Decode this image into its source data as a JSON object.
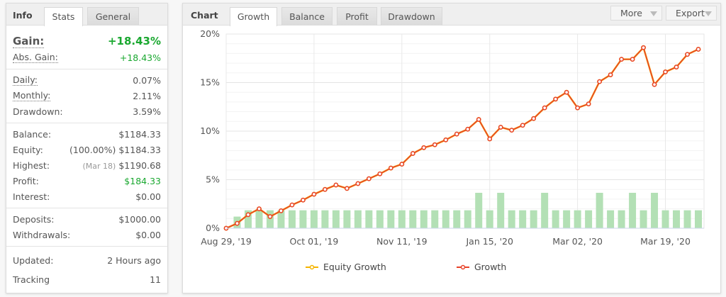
{
  "info": {
    "title": "Info",
    "tabs": [
      {
        "label": "Stats",
        "active": true
      },
      {
        "label": "General",
        "active": false
      }
    ],
    "gain": {
      "label": "Gain:",
      "value": "+18.43%"
    },
    "abs_gain": {
      "label": "Abs. Gain:",
      "value": "+18.43%"
    },
    "daily": {
      "label": "Daily:",
      "value": "0.07%"
    },
    "monthly": {
      "label": "Monthly:",
      "value": "2.11%"
    },
    "drawdown": {
      "label": "Drawdown:",
      "value": "3.59%"
    },
    "balance": {
      "label": "Balance:",
      "value": "$1184.33"
    },
    "equity": {
      "label": "Equity:",
      "note": "(100.00%)",
      "value": "$1184.33"
    },
    "highest": {
      "label": "Highest:",
      "note": "(Mar 18)",
      "value": "$1190.68"
    },
    "profit": {
      "label": "Profit:",
      "value": "$184.33"
    },
    "interest": {
      "label": "Interest:",
      "value": "$0.00"
    },
    "deposits": {
      "label": "Deposits:",
      "value": "$1000.00"
    },
    "withdrawals": {
      "label": "Withdrawals:",
      "value": "$0.00"
    },
    "updated": {
      "label": "Updated:",
      "value": "2 Hours ago"
    },
    "tracking": {
      "label": "Tracking",
      "value": "11"
    }
  },
  "chart_panel": {
    "title": "Chart",
    "tabs": [
      {
        "label": "Growth",
        "active": true
      },
      {
        "label": "Balance"
      },
      {
        "label": "Profit"
      },
      {
        "label": "Drawdown"
      }
    ],
    "more_label": "More",
    "export_label": "Export"
  },
  "colors": {
    "green": "#1aa830",
    "growth": "#e8432a",
    "equity": "#f5b400",
    "bar": "#b3e0b5"
  },
  "chart_data": {
    "type": "line",
    "ylim": [
      0,
      20
    ],
    "yticks": [
      "0%",
      "5%",
      "10%",
      "15%",
      "20%"
    ],
    "ytick_values": [
      0,
      5,
      10,
      15,
      20
    ],
    "xtick_labels": [
      {
        "label": "Aug 29, '19",
        "index": 0
      },
      {
        "label": "Oct 01, '19",
        "index": 8
      },
      {
        "label": "Nov 11, '19",
        "index": 16
      },
      {
        "label": "Jan 15, '20",
        "index": 24
      },
      {
        "label": "Mar 02, '20",
        "index": 32
      },
      {
        "label": "Mar 19, '20",
        "index": 40
      }
    ],
    "grid": true,
    "legend": "bottom",
    "series": [
      {
        "name": "Equity Growth",
        "color": "#f5b400",
        "values": [
          0,
          0.5,
          1.4,
          2.0,
          1.2,
          1.8,
          2.4,
          2.9,
          3.5,
          4.0,
          4.45,
          4.1,
          4.6,
          5.1,
          5.6,
          6.2,
          6.6,
          7.7,
          8.3,
          8.6,
          9.1,
          9.7,
          10.2,
          11.2,
          9.2,
          10.4,
          10.1,
          10.6,
          11.3,
          12.4,
          13.3,
          14.0,
          12.4,
          12.8,
          15.1,
          15.8,
          17.4,
          17.4,
          18.6,
          14.8,
          16.1,
          16.6,
          17.9,
          18.43
        ]
      },
      {
        "name": "Growth",
        "color": "#e8432a",
        "values": [
          0,
          0.5,
          1.4,
          2.0,
          1.2,
          1.8,
          2.4,
          2.9,
          3.5,
          4.0,
          4.45,
          4.1,
          4.6,
          5.1,
          5.6,
          6.2,
          6.6,
          7.7,
          8.3,
          8.6,
          9.1,
          9.7,
          10.2,
          11.2,
          9.2,
          10.4,
          10.1,
          10.6,
          11.3,
          12.4,
          13.3,
          14.0,
          12.4,
          12.8,
          15.1,
          15.8,
          17.4,
          17.4,
          18.6,
          14.8,
          16.1,
          16.6,
          17.9,
          18.43
        ]
      }
    ],
    "bars": {
      "color": "#b3e0b5",
      "values": [
        0,
        1.2,
        1.85,
        1.85,
        1.85,
        1.85,
        1.85,
        1.85,
        1.85,
        1.85,
        1.85,
        1.85,
        1.85,
        1.85,
        1.85,
        1.85,
        1.85,
        1.85,
        1.85,
        1.85,
        1.85,
        1.85,
        1.85,
        3.65,
        1.85,
        3.65,
        1.85,
        1.85,
        1.85,
        3.65,
        1.85,
        1.85,
        1.85,
        1.85,
        3.65,
        1.85,
        1.85,
        3.65,
        1.85,
        3.65,
        1.85,
        1.85,
        1.85,
        1.85
      ]
    }
  }
}
